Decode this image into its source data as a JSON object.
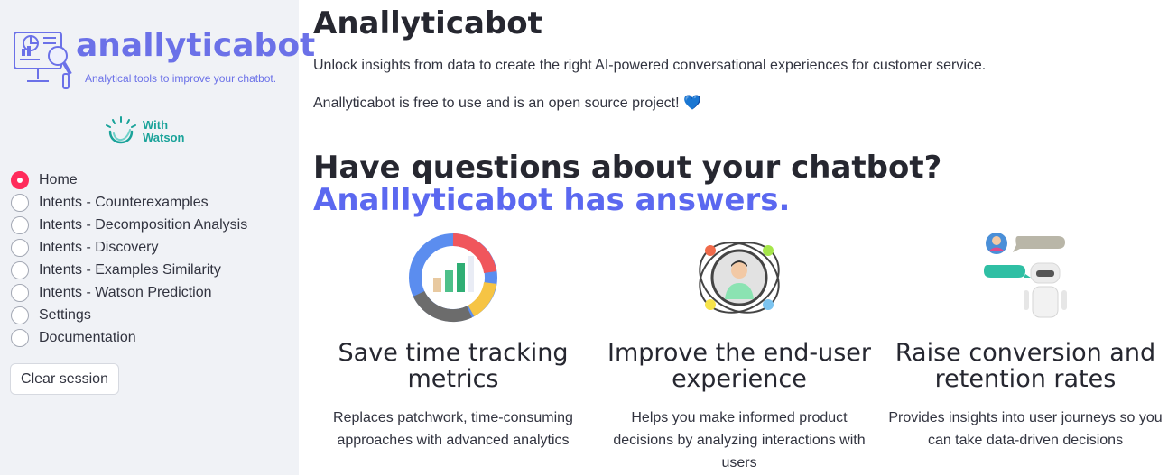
{
  "sidebar": {
    "logo": {
      "title": "anallyticabot",
      "subtitle": "Analytical tools to improve your chatbot."
    },
    "watson": {
      "line1": "With",
      "line2": "Watson"
    },
    "nav": [
      {
        "label": "Home",
        "selected": true
      },
      {
        "label": "Intents - Counterexamples",
        "selected": false
      },
      {
        "label": "Intents - Decomposition Analysis",
        "selected": false
      },
      {
        "label": "Intents - Discovery",
        "selected": false
      },
      {
        "label": "Intents - Examples Similarity",
        "selected": false
      },
      {
        "label": "Intents - Watson Prediction",
        "selected": false
      },
      {
        "label": "Settings",
        "selected": false
      },
      {
        "label": "Documentation",
        "selected": false
      }
    ],
    "clear_label": "Clear session"
  },
  "main": {
    "title": "Anallyticabot",
    "intro": "Unlock insights from data to create the right AI-powered conversational experiences for customer service.",
    "intro2": "Anallyticabot is free to use and is an open source project!",
    "heart": "💙",
    "headline_dark": "Have questions about your chatbot? ",
    "headline_accent": "Analllyticabot has answers.",
    "features": [
      {
        "icon": "analytics-chart-icon",
        "title": "Save time tracking metrics",
        "text": "Replaces patchwork, time-consuming approaches with advanced analytics"
      },
      {
        "icon": "user-experience-icon",
        "title": "Improve the end-user experience",
        "text": "Helps you make informed product decisions by analyzing interactions with users"
      },
      {
        "icon": "chatbot-conversation-icon",
        "title": "Raise conversion and retention rates",
        "text": "Provides insights into user journeys so you can take data-driven decisions"
      }
    ]
  },
  "colors": {
    "accent": "#5b68f0",
    "radio_selected": "#ff2b5b",
    "sidebar_bg": "#f0f2f6",
    "watson": "#1aa39a"
  }
}
